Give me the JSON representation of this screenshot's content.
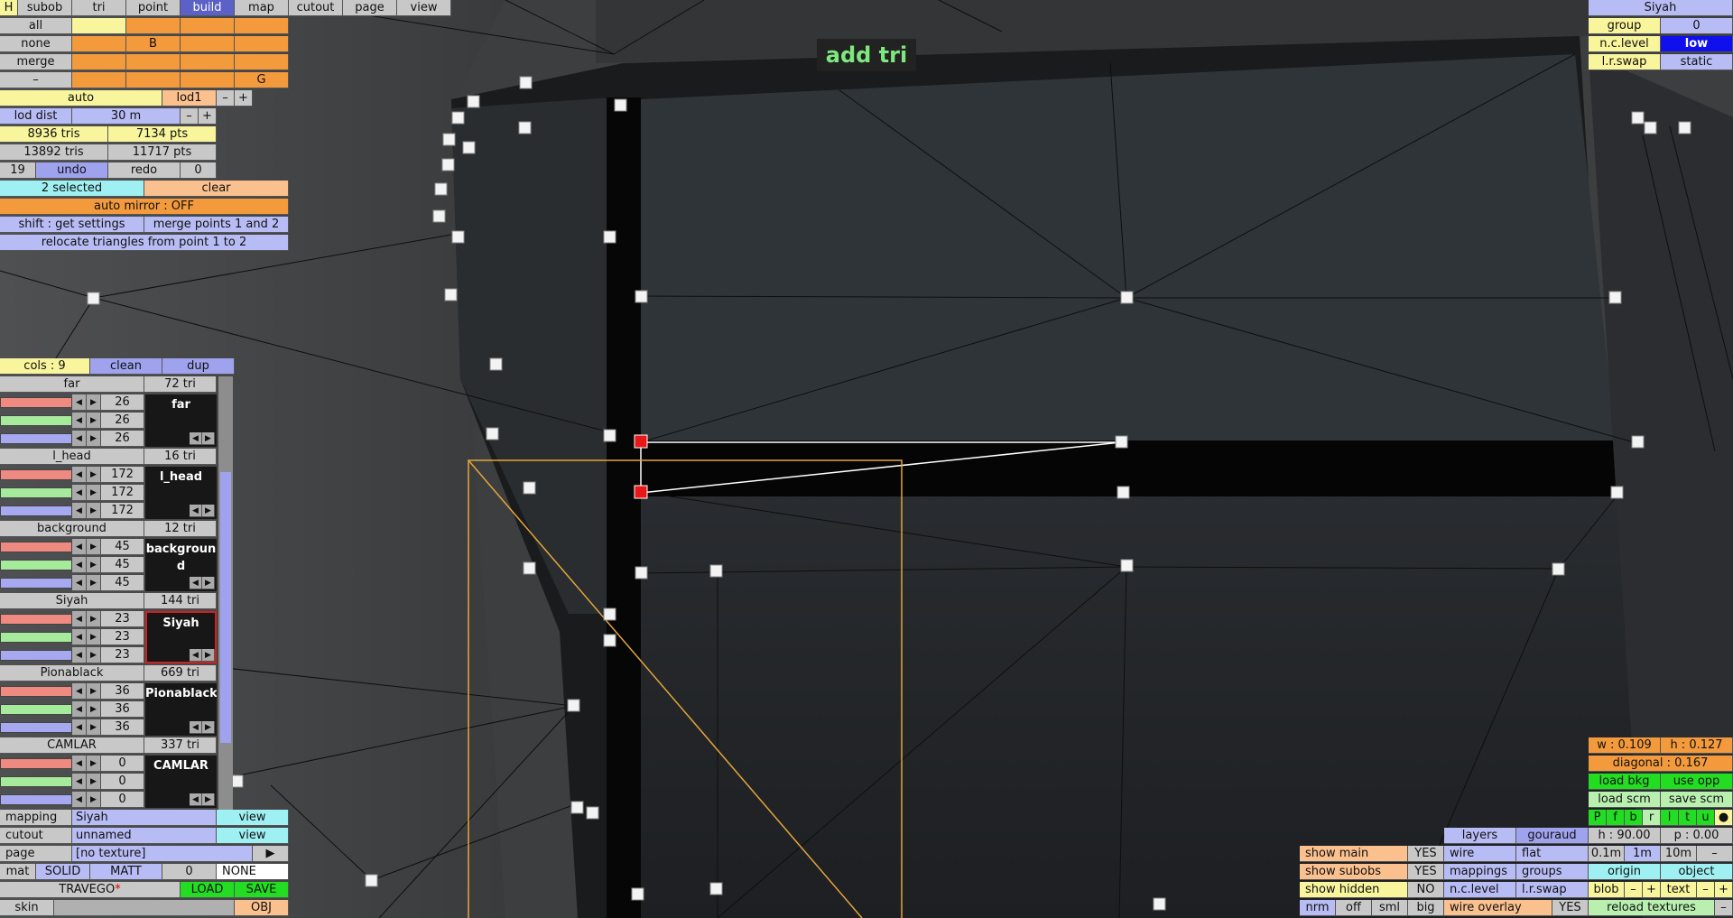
{
  "app": {
    "overlay": "add tri",
    "red_star": "*"
  },
  "tabs": [
    "H",
    "subob",
    "tri",
    "point",
    "build",
    "map",
    "cutout",
    "page",
    "view"
  ],
  "select": {
    "all": "all",
    "none": "none",
    "merge": "merge",
    "minus": "–",
    "slot_b": "B",
    "slot_g": "G"
  },
  "lod": {
    "auto": "auto",
    "level": "lod1",
    "minus": "–",
    "plus": "+",
    "dist_label": "lod dist",
    "dist_value": "30 m",
    "tris1": "8936 tris",
    "pts1": "7134 pts",
    "tris2": "13892 tris",
    "pts2": "11717 pts"
  },
  "history": {
    "count": "19",
    "undo": "undo",
    "redo": "redo",
    "redo_count": "0"
  },
  "selection": {
    "selected": "2 selected",
    "clear": "clear",
    "auto_mirror": "auto mirror : OFF",
    "shift": "shift : get settings",
    "merge_points": "merge points 1 and 2",
    "relocate": "relocate triangles from point 1 to 2"
  },
  "materials_header": {
    "cols": "cols : 9",
    "clean": "clean",
    "dup": "dup"
  },
  "materials": [
    {
      "name": "far",
      "tris": "72 tri",
      "r": "26",
      "g": "26",
      "b": "26",
      "box": "far"
    },
    {
      "name": "l_head",
      "tris": "16 tri",
      "r": "172",
      "g": "172",
      "b": "172",
      "box": "l_head"
    },
    {
      "name": "background",
      "tris": "12 tri",
      "r": "45",
      "g": "45",
      "b": "45",
      "box": "backgroun d"
    },
    {
      "name": "Siyah",
      "tris": "144 tri",
      "r": "23",
      "g": "23",
      "b": "23",
      "box": "Siyah"
    },
    {
      "name": "Pionablack",
      "tris": "669 tri",
      "r": "36",
      "g": "36",
      "b": "36",
      "box": "Pionablack"
    },
    {
      "name": "CAMLAR",
      "tris": "337 tri",
      "r": "0",
      "g": "0",
      "b": "0",
      "box": "CAMLAR"
    }
  ],
  "bottom_left": {
    "mapping_label": "mapping",
    "mapping_value": "Siyah",
    "view1": "view",
    "cutout_label": "cutout",
    "cutout_value": "unnamed",
    "view2": "view",
    "page_label": "page",
    "page_value": "[no texture]",
    "page_arrow": "▶",
    "mat": "mat",
    "solid": "SOLID",
    "matt": "MATT",
    "mat_num": "0",
    "none": "NONE",
    "name": "TRAVEGO",
    "load": "LOAD",
    "save": "SAVE",
    "skin": "skin",
    "obj": "OBJ"
  },
  "top_right": {
    "title": "Siyah",
    "group_label": "group",
    "group_value": "0",
    "ncl_label": "n.c.level",
    "ncl_value": "low",
    "lrswap_label": "l.r.swap",
    "lrswap_value": "static"
  },
  "bottom_right": {
    "w": "w : 0.109",
    "h": "h : 0.127",
    "diagonal": "diagonal : 0.167",
    "load_bkg": "load bkg",
    "use_opp": "use opp",
    "load_scm": "load scm",
    "save_scm": "save scm",
    "views": [
      "P",
      "f",
      "b",
      "r",
      "l",
      "t",
      "u",
      "●"
    ],
    "layers": "layers",
    "gouraud": "gouraud",
    "h90": "h : 90.00",
    "p0": "p : 0.00",
    "show_main": "show main",
    "show_main_v": "YES",
    "wire": "wire",
    "flat": "flat",
    "s01": "0.1m",
    "s1": "1m",
    "s10": "10m",
    "sminus": "–",
    "show_subobs": "show subobs",
    "show_subobs_v": "YES",
    "mappings": "mappings",
    "groups": "groups",
    "origin": "origin",
    "object": "object",
    "show_hidden": "show hidden",
    "show_hidden_v": "NO",
    "ncl": "n.c.level",
    "lrswap": "l.r.swap",
    "blob": "blob",
    "bminus": "–",
    "bplus": "+",
    "text": "text",
    "tminus": "–",
    "tplus": "+",
    "nrm": "nrm",
    "off": "off",
    "sml": "sml",
    "big": "big",
    "wire_overlay": "wire overlay",
    "wire_overlay_v": "YES",
    "reload": "reload textures",
    "rminus": "–"
  }
}
